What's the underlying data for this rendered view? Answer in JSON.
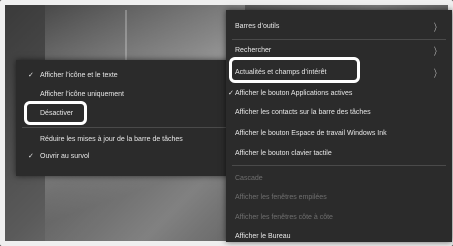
{
  "left_menu": {
    "items": [
      {
        "label": "Afficher l’icône et le texte",
        "checked": true
      },
      {
        "label": "Afficher l’icône uniquement",
        "checked": false
      },
      {
        "label": "Désactiver",
        "checked": false,
        "highlighted": true
      },
      {
        "label": "Réduire les mises à jour de la barre de tâches",
        "checked": false
      },
      {
        "label": "Ouvrir au survol",
        "checked": true
      }
    ]
  },
  "right_menu": {
    "items": [
      {
        "label": "Barres d’outils",
        "submenu": true
      },
      {
        "label": "Rechercher",
        "submenu": true
      },
      {
        "label": "Actualités et champs d’intérêt",
        "submenu": true,
        "highlighted": true
      },
      {
        "label": "Afficher le bouton Applications actives",
        "checked": true
      },
      {
        "label": "Afficher les contacts sur la barre des tâches"
      },
      {
        "label": "Afficher le bouton Espace de travail Windows Ink"
      },
      {
        "label": "Afficher le bouton clavier tactile"
      },
      {
        "label": "Cascade",
        "disabled": true
      },
      {
        "label": "Afficher les fenêtres empilées",
        "disabled": true
      },
      {
        "label": "Afficher les fenêtres côte à côte",
        "disabled": true
      },
      {
        "label": "Afficher le Bureau"
      }
    ]
  },
  "icons": {
    "check": "✓",
    "submenu_arrow": "〉"
  }
}
